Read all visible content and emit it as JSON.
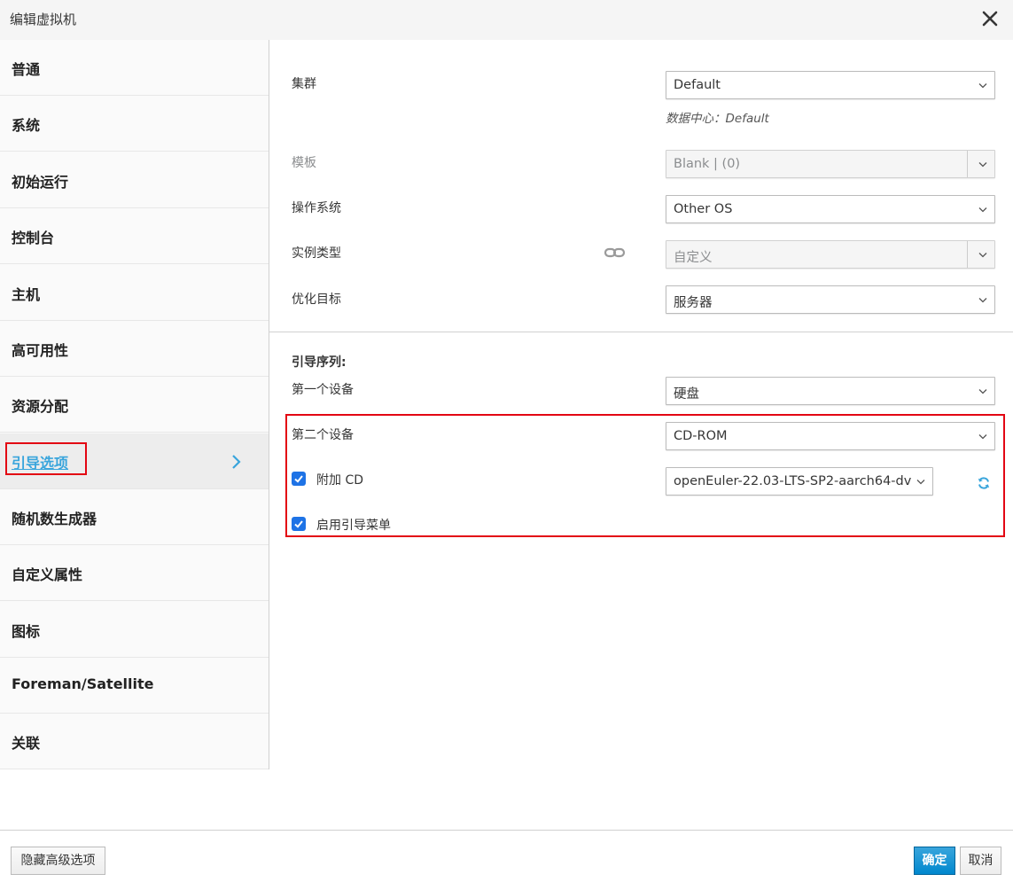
{
  "dialog": {
    "title": "编辑虚拟机"
  },
  "sidebar": {
    "items": [
      {
        "label": "普通"
      },
      {
        "label": "系统"
      },
      {
        "label": "初始运行"
      },
      {
        "label": "控制台"
      },
      {
        "label": "主机"
      },
      {
        "label": "高可用性"
      },
      {
        "label": "资源分配"
      },
      {
        "label": "引导选项",
        "active": true
      },
      {
        "label": "随机数生成器"
      },
      {
        "label": "自定义属性"
      },
      {
        "label": "图标"
      },
      {
        "label": "Foreman/Satellite"
      },
      {
        "label": "关联"
      }
    ]
  },
  "form": {
    "cluster": {
      "label": "集群",
      "value": "Default",
      "hint": "数据中心：Default"
    },
    "template": {
      "label": "模板",
      "value": "Blank |  (0)"
    },
    "os": {
      "label": "操作系统",
      "value": "Other OS"
    },
    "instance_type": {
      "label": "实例类型",
      "value": "自定义"
    },
    "optimize": {
      "label": "优化目标",
      "value": "服务器"
    }
  },
  "boot": {
    "section_title": "引导序列:",
    "first_device": {
      "label": "第一个设备",
      "value": "硬盘"
    },
    "second_device": {
      "label": "第二个设备",
      "value": "CD-ROM"
    },
    "attach_cd": {
      "label": "附加 CD",
      "checked": true,
      "value": "openEuler-22.03-LTS-SP2-aarch64-dv"
    },
    "boot_menu": {
      "label": "启用引导菜单",
      "checked": true
    }
  },
  "footer": {
    "hide_advanced": "隐藏高级选项",
    "ok": "确定",
    "cancel": "取消"
  },
  "colors": {
    "accent": "#39a5dc",
    "primary_button": "#0088ce",
    "highlight_border": "#e30613",
    "checkbox": "#1e73e6"
  }
}
